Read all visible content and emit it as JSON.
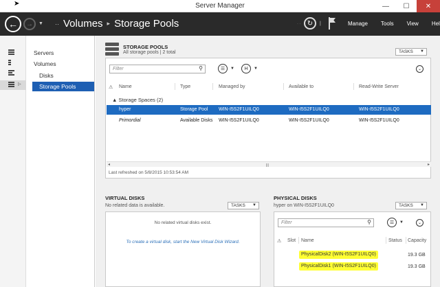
{
  "window": {
    "title": "Server Manager",
    "controls": {
      "minimize": "—",
      "maximize": "☐",
      "close": "✕"
    }
  },
  "header": {
    "breadcrumb": [
      "Volumes",
      "Storage Pools"
    ],
    "prefix": "··",
    "menus": [
      "Manage",
      "Tools",
      "View",
      "Help"
    ]
  },
  "leftnav": {
    "items": [
      "Servers",
      "Volumes",
      "Disks",
      "Storage Pools"
    ],
    "selected": "Storage Pools"
  },
  "storage_pools": {
    "title": "STORAGE POOLS",
    "subtitle": "All storage pools | 2 total",
    "tasks_label": "TASKS",
    "filter_placeholder": "Filter",
    "columns": [
      "Name",
      "Type",
      "Managed by",
      "Available to",
      "Read-Write Server"
    ],
    "group_label": "Storage Spaces (2)",
    "rows": [
      {
        "name": "hyper",
        "type": "Storage Pool",
        "managed_by": "WIN-I5S2F1UILQ0",
        "available_to": "WIN-I5S2F1UILQ0",
        "rw_server": "WIN-I5S2F1UILQ0",
        "selected": true
      },
      {
        "name": "Primordial",
        "type": "Available Disks",
        "managed_by": "WIN-I5S2F1UILQ0",
        "available_to": "WIN-I5S2F1UILQ0",
        "rw_server": "WIN-I5S2F1UILQ0",
        "selected": false
      }
    ],
    "last_refreshed": "Last refreshed on 5/8/2015 10:53:54 AM"
  },
  "virtual_disks": {
    "title": "VIRTUAL DISKS",
    "subtitle": "No related data is available.",
    "tasks_label": "TASKS",
    "empty_message": "No related virtual disks exist.",
    "create_link": "To create a virtual disk, start the New Virtual Disk Wizard."
  },
  "physical_disks": {
    "title": "PHYSICAL DISKS",
    "subtitle": "hyper on WIN-I5S2F1UILQ0",
    "tasks_label": "TASKS",
    "filter_placeholder": "Filter",
    "columns": [
      "Slot",
      "Name",
      "Status",
      "Capacity"
    ],
    "rows": [
      {
        "name": "PhysicalDisk2 (WIN-I5S2F1UILQ0)",
        "capacity": "19.3 GB"
      },
      {
        "name": "PhysicalDisk1 (WIN-I5S2F1UILQ0)",
        "capacity": "19.3 GB"
      }
    ],
    "highlight_color": "#ffff33"
  },
  "colors": {
    "header_bg": "#2a2a2a",
    "selection": "#1e6bc1",
    "close_button": "#c7413a"
  },
  "icons": {
    "back": "back-arrow-icon",
    "forward": "forward-arrow-icon",
    "refresh": "refresh-icon",
    "flag": "notifications-flag-icon",
    "search": "search-icon"
  }
}
